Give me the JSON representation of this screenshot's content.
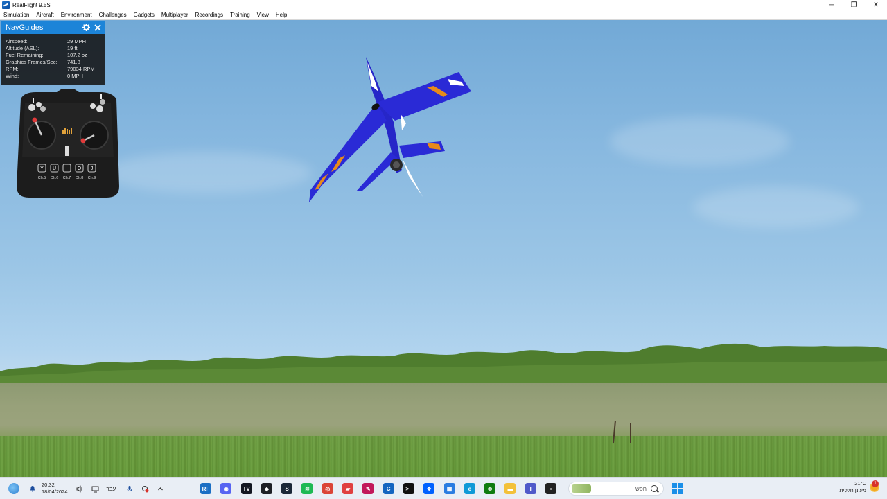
{
  "window": {
    "title": "RealFlight 9.5S",
    "minimize_glyph": "─",
    "maximize_glyph": "❐",
    "close_glyph": "✕"
  },
  "menu": {
    "items": [
      "Simulation",
      "Aircraft",
      "Environment",
      "Challenges",
      "Gadgets",
      "Multiplayer",
      "Recordings",
      "Training",
      "View",
      "Help"
    ]
  },
  "navguides": {
    "title": "NavGuides",
    "settings_icon": "gear-icon",
    "close_icon": "close-icon",
    "rows": [
      {
        "label": "Airspeed:",
        "value": "29 MPH"
      },
      {
        "label": "Altitude (ASL):",
        "value": "19 ft"
      },
      {
        "label": "Fuel Remaining:",
        "value": "107.2 oz"
      },
      {
        "label": "Graphics Frames/Sec:",
        "value": "741.8"
      },
      {
        "label": "RPM:",
        "value": "79034 RPM"
      },
      {
        "label": "Wind:",
        "value": "0 MPH"
      }
    ]
  },
  "transmitter": {
    "buttons": [
      "Y",
      "U",
      "I",
      "O",
      "J"
    ],
    "channels": [
      "Ch.5",
      "Ch.6",
      "Ch.7",
      "Ch.8",
      "Ch.9"
    ]
  },
  "taskbar": {
    "time": "20:32",
    "date": "18/04/2024",
    "language": "עבר",
    "search_placeholder": "חפש",
    "weather_temp": "21°C",
    "weather_desc": "מעונן חלקית",
    "weather_badge": "1",
    "apps": [
      {
        "name": "realflight-app-icon",
        "color": "#1c6fc4",
        "glyph": "RF"
      },
      {
        "name": "discord-app-icon",
        "color": "#5865f2",
        "glyph": "◉"
      },
      {
        "name": "tradingview-app-icon",
        "color": "#131722",
        "glyph": "TV"
      },
      {
        "name": "binance-app-icon",
        "color": "#1e2026",
        "glyph": "◆"
      },
      {
        "name": "steam-app-icon",
        "color": "#1b2838",
        "glyph": "S"
      },
      {
        "name": "spotify-app-icon",
        "color": "#1db954",
        "glyph": "≋"
      },
      {
        "name": "chrome-app-icon",
        "color": "#db4437",
        "glyph": "◎"
      },
      {
        "name": "media-app-icon",
        "color": "#e04040",
        "glyph": "▰"
      },
      {
        "name": "pen-app-icon",
        "color": "#c2185b",
        "glyph": "✎"
      },
      {
        "name": "cursor-app-icon",
        "color": "#1565c0",
        "glyph": "C"
      },
      {
        "name": "terminal-app-icon",
        "color": "#111111",
        "glyph": ">_"
      },
      {
        "name": "dropbox-app-icon",
        "color": "#0061ff",
        "glyph": "❖"
      },
      {
        "name": "store-app-icon",
        "color": "#2a7de1",
        "glyph": "▦"
      },
      {
        "name": "edge-app-icon",
        "color": "#0f9ad7",
        "glyph": "e"
      },
      {
        "name": "xbox-app-icon",
        "color": "#107c10",
        "glyph": "⊗"
      },
      {
        "name": "folder-app-icon",
        "color": "#f3c13a",
        "glyph": "▬"
      },
      {
        "name": "teams-app-icon",
        "color": "#5059c9",
        "glyph": "T"
      },
      {
        "name": "black-app-icon",
        "color": "#222222",
        "glyph": "▪"
      }
    ]
  },
  "colors": {
    "navguides_header": "#1c84d8",
    "plane_body": "#2a2ad0",
    "plane_accent": "#e88a1a"
  }
}
